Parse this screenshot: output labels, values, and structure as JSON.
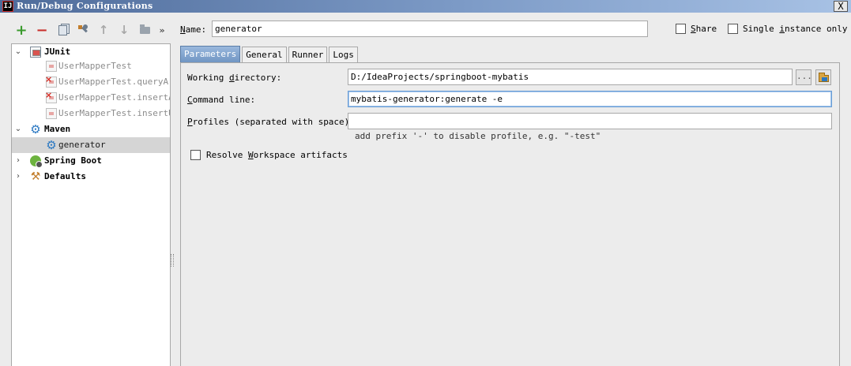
{
  "window": {
    "title": "Run/Debug Configurations",
    "app_icon": "intellij-icon",
    "close_glyph": "X"
  },
  "toolbar": {
    "add": "+",
    "remove": "−",
    "up": "↑",
    "down": "↓",
    "more": "»"
  },
  "tree": {
    "junit": {
      "label": "JUnit",
      "expanded": true
    },
    "junit_items": [
      {
        "label": "UserMapperTest",
        "error": false
      },
      {
        "label": "UserMapperTest.queryArea",
        "error": true
      },
      {
        "label": "UserMapperTest.insertArea",
        "error": true
      },
      {
        "label": "UserMapperTest.insertUser",
        "error": false
      }
    ],
    "maven": {
      "label": "Maven",
      "expanded": true
    },
    "maven_items": [
      {
        "label": "generator",
        "selected": true
      }
    ],
    "spring_boot": {
      "label": "Spring Boot",
      "expanded": false
    },
    "defaults": {
      "label": "Defaults",
      "expanded": false
    }
  },
  "config": {
    "name_label_mnemonic": "N",
    "name_label_rest": "ame:",
    "name_value": "generator",
    "share_mnemonic": "S",
    "share_rest": "hare",
    "share_checked": false,
    "single_instance_prefix": "Single ",
    "single_instance_mnemonic": "i",
    "single_instance_rest": "nstance only",
    "single_instance_checked": false
  },
  "tabs": [
    {
      "label": "Parameters",
      "active": true
    },
    {
      "label": "General",
      "active": false
    },
    {
      "label": "Runner",
      "active": false
    },
    {
      "label": "Logs",
      "active": false
    }
  ],
  "parameters": {
    "working_dir_prefix": "Working ",
    "working_dir_mnemonic": "d",
    "working_dir_rest": "irectory:",
    "working_dir_value": "D:/IdeaProjects/springboot-mybatis",
    "browse_label": "...",
    "command_line_mnemonic": "C",
    "command_line_rest": "ommand line:",
    "command_line_value": "mybatis-generator:generate -e",
    "profiles_mnemonic": "P",
    "profiles_rest": "rofiles (separated with space):",
    "profiles_value": "",
    "profiles_hint": "add prefix '-' to disable profile, e.g. \"-test\"",
    "resolve_prefix": "Resolve ",
    "resolve_mnemonic": "W",
    "resolve_rest": "orkspace artifacts",
    "resolve_checked": false
  }
}
